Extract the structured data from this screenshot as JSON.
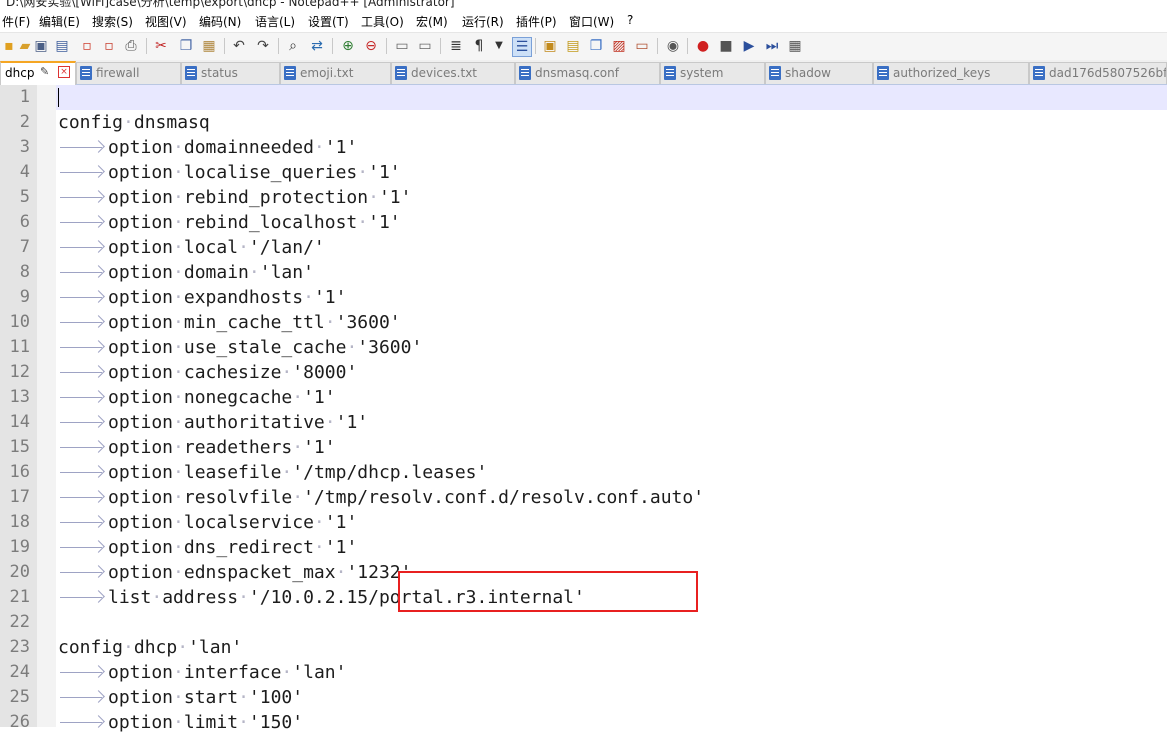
{
  "window": {
    "title_fragment": "D:\\网安实验\\[WiFi]case\\分析\\temp\\export\\dhcp - Notepad++ [Administrator]"
  },
  "menu": [
    "件(F)",
    "编辑(E)",
    "搜索(S)",
    "视图(V)",
    "编码(N)",
    "语言(L)",
    "设置(T)",
    "工具(O)",
    "宏(M)",
    "运行(R)",
    "插件(P)",
    "窗口(W)",
    "?"
  ],
  "tabs": [
    {
      "label": "dhcp",
      "active": true
    },
    {
      "label": "firewall"
    },
    {
      "label": "status"
    },
    {
      "label": "emoji.txt"
    },
    {
      "label": "devices.txt"
    },
    {
      "label": "dnsmasq.conf"
    },
    {
      "label": "system"
    },
    {
      "label": "shadow"
    },
    {
      "label": "authorized_keys"
    },
    {
      "label": "dad176d5807526bf"
    }
  ],
  "toolbar_icons": [
    "new-icon",
    "open-icon",
    "save-icon",
    "save-all-icon",
    "close-icon",
    "close-all-icon",
    "print-icon",
    "cut-icon",
    "copy-icon",
    "paste-icon",
    "undo-icon",
    "redo-icon",
    "find-icon",
    "replace-icon",
    "zoom-in-icon",
    "zoom-out-icon",
    "sync-v-icon",
    "sync-h-icon",
    "word-wrap-icon",
    "show-all-chars-icon",
    "indent-guide-icon",
    "udl-icon",
    "doc-map-icon",
    "function-list-icon",
    "folder-workspace-icon",
    "monitor-icon",
    "record-macro-icon",
    "stop-record-icon",
    "play-macro-icon",
    "run-macro-multiple-icon",
    "save-macro-icon"
  ],
  "code_lines": [
    {
      "n": "1",
      "indent": false,
      "text": ""
    },
    {
      "n": "2",
      "indent": false,
      "text": "config·dnsmasq"
    },
    {
      "n": "3",
      "indent": true,
      "text": "option·domainneeded·'1'"
    },
    {
      "n": "4",
      "indent": true,
      "text": "option·localise_queries·'1'"
    },
    {
      "n": "5",
      "indent": true,
      "text": "option·rebind_protection·'1'"
    },
    {
      "n": "6",
      "indent": true,
      "text": "option·rebind_localhost·'1'"
    },
    {
      "n": "7",
      "indent": true,
      "text": "option·local·'/lan/'"
    },
    {
      "n": "8",
      "indent": true,
      "text": "option·domain·'lan'"
    },
    {
      "n": "9",
      "indent": true,
      "text": "option·expandhosts·'1'"
    },
    {
      "n": "10",
      "indent": true,
      "text": "option·min_cache_ttl·'3600'"
    },
    {
      "n": "11",
      "indent": true,
      "text": "option·use_stale_cache·'3600'"
    },
    {
      "n": "12",
      "indent": true,
      "text": "option·cachesize·'8000'"
    },
    {
      "n": "13",
      "indent": true,
      "text": "option·nonegcache·'1'"
    },
    {
      "n": "14",
      "indent": true,
      "text": "option·authoritative·'1'"
    },
    {
      "n": "15",
      "indent": true,
      "text": "option·readethers·'1'"
    },
    {
      "n": "16",
      "indent": true,
      "text": "option·leasefile·'/tmp/dhcp.leases'"
    },
    {
      "n": "17",
      "indent": true,
      "text": "option·resolvfile·'/tmp/resolv.conf.d/resolv.conf.auto'"
    },
    {
      "n": "18",
      "indent": true,
      "text": "option·localservice·'1'"
    },
    {
      "n": "19",
      "indent": true,
      "text": "option·dns_redirect·'1'"
    },
    {
      "n": "20",
      "indent": true,
      "text": "option·ednspacket_max·'1232'"
    },
    {
      "n": "21",
      "indent": true,
      "text": "list·address·'/10.0.2.15/portal.r3.internal'"
    },
    {
      "n": "22",
      "indent": false,
      "text": ""
    },
    {
      "n": "23",
      "indent": false,
      "text": "config·dhcp·'lan'"
    },
    {
      "n": "24",
      "indent": true,
      "text": "option·interface·'lan'"
    },
    {
      "n": "25",
      "indent": true,
      "text": "option·start·'100'"
    },
    {
      "n": "26",
      "indent": true,
      "text": "option·limit·'150'"
    }
  ]
}
